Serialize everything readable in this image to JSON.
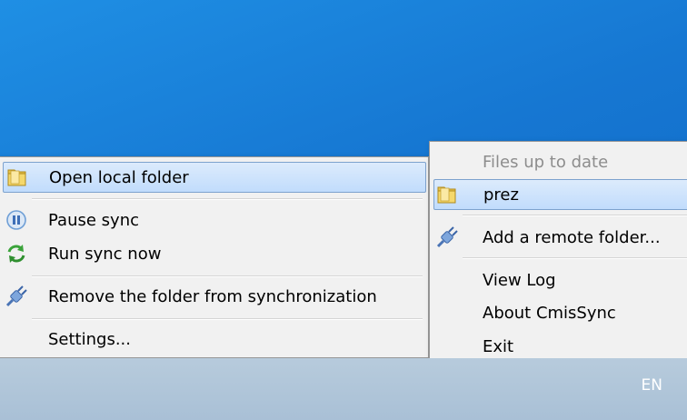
{
  "left_menu": {
    "items": [
      {
        "label": "Open local folder",
        "icon": "folder-icon",
        "highlighted": true
      },
      {
        "label": "Pause sync",
        "icon": "pause-icon"
      },
      {
        "label": "Run sync now",
        "icon": "sync-icon"
      },
      {
        "label": "Remove the folder from synchronization",
        "icon": "plug-icon"
      },
      {
        "label": "Settings..."
      }
    ]
  },
  "right_menu": {
    "items": [
      {
        "label": "Files up to date",
        "disabled": true
      },
      {
        "label": "prez",
        "icon": "folder-icon",
        "highlighted": true
      },
      {
        "label": "Add a remote folder...",
        "icon": "plug-icon"
      },
      {
        "label": "View Log"
      },
      {
        "label": "About CmisSync"
      },
      {
        "label": "Exit"
      }
    ]
  },
  "taskbar": {
    "language": "EN"
  },
  "colors": {
    "desktop": "#1677d2",
    "highlight": "#c1dcfc",
    "menu_bg": "#f1f1f1"
  }
}
